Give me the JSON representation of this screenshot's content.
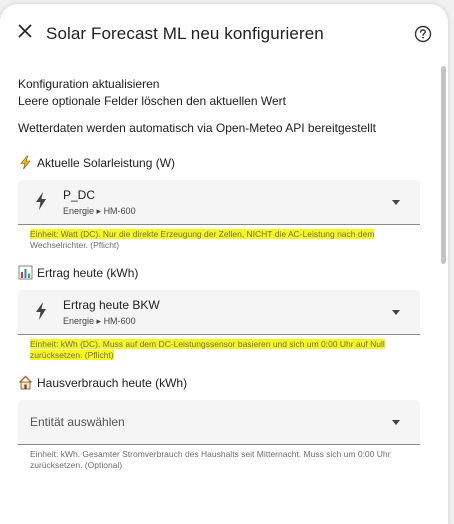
{
  "dialog": {
    "title": "Solar Forecast ML neu konfigurieren",
    "close_icon": "close-icon",
    "help_icon": "help-circle-icon"
  },
  "intro": {
    "line1": "Konfiguration aktualisieren",
    "line2": "Leere optionale Felder löschen den aktuellen Wert",
    "line3": "Wetterdaten werden automatisch via Open-Meteo API bereitgestellt"
  },
  "sections": [
    {
      "label": "Aktuelle Solarleistung (W)",
      "icon": "lightning-icon",
      "entity_name": "P_DC",
      "entity_sub_domain": "Energie",
      "entity_sub_device": "HM-600",
      "helper_line1": "Einheit: Watt (DC). Nur die direkte Erzeugung der Zellen, NICHT die AC-Leistung nach dem",
      "helper_line2": "Wechselrichter. (Pflicht)"
    },
    {
      "label": "Ertrag heute (kWh)",
      "icon": "bar-chart-icon",
      "entity_name": "Ertrag heute BKW",
      "entity_sub_domain": "Energie",
      "entity_sub_device": "HM-600",
      "helper_line1": "Einheit: kWh (DC). Muss auf dem DC-Leistungssensor basieren und sich um 0:00 Uhr auf Null",
      "helper_line2": "zurücksetzen. (Pflicht)"
    },
    {
      "label": "Hausverbrauch heute (kWh)",
      "icon": "house-icon",
      "placeholder": "Entität auswählen",
      "helper_line1": "Einheit: kWh. Gesamter Stromverbrauch des Haushalts seit Mitternacht. Muss sich um 0:00 Uhr",
      "helper_line2": "zurücksetzen. (Optional)"
    }
  ],
  "colors": {
    "highlight": "#f7f71c",
    "field_bg": "#f5f5f5",
    "helper_text": "#6f6f6f"
  }
}
